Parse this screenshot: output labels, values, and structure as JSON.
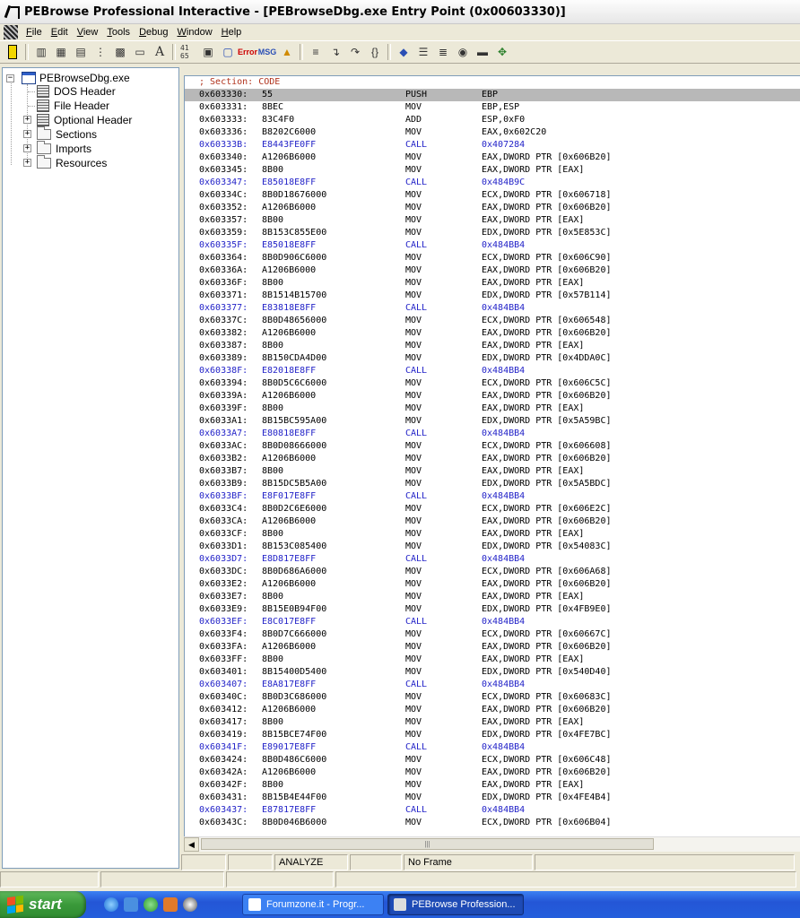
{
  "window": {
    "title": "PEBrowse Professional Interactive - [PEBrowseDbg.exe Entry Point (0x00603330)]"
  },
  "menu": [
    {
      "label": "File",
      "u": "F",
      "rest": "ile"
    },
    {
      "label": "Edit",
      "u": "E",
      "rest": "dit"
    },
    {
      "label": "View",
      "u": "V",
      "rest": "iew"
    },
    {
      "label": "Tools",
      "u": "T",
      "rest": "ools"
    },
    {
      "label": "Debug",
      "u": "D",
      "rest": "ebug"
    },
    {
      "label": "Window",
      "u": "W",
      "rest": "indow"
    },
    {
      "label": "Help",
      "u": "H",
      "rest": "elp"
    }
  ],
  "toolbar": {
    "icons": [
      "open-icon",
      "chart-icon",
      "grid-icon",
      "print-icon",
      "tree-icon",
      "pe-icon",
      "hex-icon",
      "font-icon",
      "bytes-icon",
      "calculator-icon",
      "copy-icon",
      "error-icon",
      "msg-icon",
      "user-icon",
      "doc-icon",
      "step-into-icon",
      "step-over-icon",
      "step-out-icon",
      "tag-icon",
      "list-icon",
      "list2-icon",
      "disk-icon",
      "monitor-icon",
      "modules-icon"
    ],
    "labels": {
      "bytes": "41 65",
      "error": "Error",
      "msg": "MSG"
    }
  },
  "tree": {
    "root": "PEBrowseDbg.exe",
    "items": [
      "DOS Header",
      "File Header",
      "Optional Header",
      "Sections",
      "Imports",
      "Resources"
    ]
  },
  "disasm": {
    "section_label": "; Section: CODE",
    "rows": [
      [
        "0x603330:",
        "55",
        "PUSH",
        "EBP"
      ],
      [
        "0x603331:",
        "8BEC",
        "MOV",
        "EBP,ESP"
      ],
      [
        "0x603333:",
        "83C4F0",
        "ADD",
        "ESP,0xF0"
      ],
      [
        "0x603336:",
        "B8202C6000",
        "MOV",
        "EAX,0x602C20"
      ],
      [
        "0x60333B:",
        "E8443FE0FF",
        "CALL",
        "0x407284"
      ],
      [
        "0x603340:",
        "A1206B6000",
        "MOV",
        "EAX,DWORD PTR [0x606B20]"
      ],
      [
        "0x603345:",
        "8B00",
        "MOV",
        "EAX,DWORD PTR [EAX]"
      ],
      [
        "0x603347:",
        "E85018E8FF",
        "CALL",
        "0x484B9C"
      ],
      [
        "0x60334C:",
        "8B0D18676000",
        "MOV",
        "ECX,DWORD PTR [0x606718]"
      ],
      [
        "0x603352:",
        "A1206B6000",
        "MOV",
        "EAX,DWORD PTR [0x606B20]"
      ],
      [
        "0x603357:",
        "8B00",
        "MOV",
        "EAX,DWORD PTR [EAX]"
      ],
      [
        "0x603359:",
        "8B153C855E00",
        "MOV",
        "EDX,DWORD PTR [0x5E853C]"
      ],
      [
        "0x60335F:",
        "E85018E8FF",
        "CALL",
        "0x484BB4"
      ],
      [
        "0x603364:",
        "8B0D906C6000",
        "MOV",
        "ECX,DWORD PTR [0x606C90]"
      ],
      [
        "0x60336A:",
        "A1206B6000",
        "MOV",
        "EAX,DWORD PTR [0x606B20]"
      ],
      [
        "0x60336F:",
        "8B00",
        "MOV",
        "EAX,DWORD PTR [EAX]"
      ],
      [
        "0x603371:",
        "8B1514B15700",
        "MOV",
        "EDX,DWORD PTR [0x57B114]"
      ],
      [
        "0x603377:",
        "E83818E8FF",
        "CALL",
        "0x484BB4"
      ],
      [
        "0x60337C:",
        "8B0D48656000",
        "MOV",
        "ECX,DWORD PTR [0x606548]"
      ],
      [
        "0x603382:",
        "A1206B6000",
        "MOV",
        "EAX,DWORD PTR [0x606B20]"
      ],
      [
        "0x603387:",
        "8B00",
        "MOV",
        "EAX,DWORD PTR [EAX]"
      ],
      [
        "0x603389:",
        "8B150CDA4D00",
        "MOV",
        "EDX,DWORD PTR [0x4DDA0C]"
      ],
      [
        "0x60338F:",
        "E82018E8FF",
        "CALL",
        "0x484BB4"
      ],
      [
        "0x603394:",
        "8B0D5C6C6000",
        "MOV",
        "ECX,DWORD PTR [0x606C5C]"
      ],
      [
        "0x60339A:",
        "A1206B6000",
        "MOV",
        "EAX,DWORD PTR [0x606B20]"
      ],
      [
        "0x60339F:",
        "8B00",
        "MOV",
        "EAX,DWORD PTR [EAX]"
      ],
      [
        "0x6033A1:",
        "8B15BC595A00",
        "MOV",
        "EDX,DWORD PTR [0x5A59BC]"
      ],
      [
        "0x6033A7:",
        "E80818E8FF",
        "CALL",
        "0x484BB4"
      ],
      [
        "0x6033AC:",
        "8B0D08666000",
        "MOV",
        "ECX,DWORD PTR [0x606608]"
      ],
      [
        "0x6033B2:",
        "A1206B6000",
        "MOV",
        "EAX,DWORD PTR [0x606B20]"
      ],
      [
        "0x6033B7:",
        "8B00",
        "MOV",
        "EAX,DWORD PTR [EAX]"
      ],
      [
        "0x6033B9:",
        "8B15DC5B5A00",
        "MOV",
        "EDX,DWORD PTR [0x5A5BDC]"
      ],
      [
        "0x6033BF:",
        "E8F017E8FF",
        "CALL",
        "0x484BB4"
      ],
      [
        "0x6033C4:",
        "8B0D2C6E6000",
        "MOV",
        "ECX,DWORD PTR [0x606E2C]"
      ],
      [
        "0x6033CA:",
        "A1206B6000",
        "MOV",
        "EAX,DWORD PTR [0x606B20]"
      ],
      [
        "0x6033CF:",
        "8B00",
        "MOV",
        "EAX,DWORD PTR [EAX]"
      ],
      [
        "0x6033D1:",
        "8B153C085400",
        "MOV",
        "EDX,DWORD PTR [0x54083C]"
      ],
      [
        "0x6033D7:",
        "E8D817E8FF",
        "CALL",
        "0x484BB4"
      ],
      [
        "0x6033DC:",
        "8B0D686A6000",
        "MOV",
        "ECX,DWORD PTR [0x606A68]"
      ],
      [
        "0x6033E2:",
        "A1206B6000",
        "MOV",
        "EAX,DWORD PTR [0x606B20]"
      ],
      [
        "0x6033E7:",
        "8B00",
        "MOV",
        "EAX,DWORD PTR [EAX]"
      ],
      [
        "0x6033E9:",
        "8B15E0B94F00",
        "MOV",
        "EDX,DWORD PTR [0x4FB9E0]"
      ],
      [
        "0x6033EF:",
        "E8C017E8FF",
        "CALL",
        "0x484BB4"
      ],
      [
        "0x6033F4:",
        "8B0D7C666000",
        "MOV",
        "ECX,DWORD PTR [0x60667C]"
      ],
      [
        "0x6033FA:",
        "A1206B6000",
        "MOV",
        "EAX,DWORD PTR [0x606B20]"
      ],
      [
        "0x6033FF:",
        "8B00",
        "MOV",
        "EAX,DWORD PTR [EAX]"
      ],
      [
        "0x603401:",
        "8B15400D5400",
        "MOV",
        "EDX,DWORD PTR [0x540D40]"
      ],
      [
        "0x603407:",
        "E8A817E8FF",
        "CALL",
        "0x484BB4"
      ],
      [
        "0x60340C:",
        "8B0D3C686000",
        "MOV",
        "ECX,DWORD PTR [0x60683C]"
      ],
      [
        "0x603412:",
        "A1206B6000",
        "MOV",
        "EAX,DWORD PTR [0x606B20]"
      ],
      [
        "0x603417:",
        "8B00",
        "MOV",
        "EAX,DWORD PTR [EAX]"
      ],
      [
        "0x603419:",
        "8B15BCE74F00",
        "MOV",
        "EDX,DWORD PTR [0x4FE7BC]"
      ],
      [
        "0x60341F:",
        "E89017E8FF",
        "CALL",
        "0x484BB4"
      ],
      [
        "0x603424:",
        "8B0D486C6000",
        "MOV",
        "ECX,DWORD PTR [0x606C48]"
      ],
      [
        "0x60342A:",
        "A1206B6000",
        "MOV",
        "EAX,DWORD PTR [0x606B20]"
      ],
      [
        "0x60342F:",
        "8B00",
        "MOV",
        "EAX,DWORD PTR [EAX]"
      ],
      [
        "0x603431:",
        "8B15B4E44F00",
        "MOV",
        "EDX,DWORD PTR [0x4FE4B4]"
      ],
      [
        "0x603437:",
        "E87817E8FF",
        "CALL",
        "0x484BB4"
      ],
      [
        "0x60343C:",
        "8B0D046B6000",
        "MOV",
        "ECX,DWORD PTR [0x606B04]"
      ]
    ],
    "selected_row": 0
  },
  "mdi_status": [
    "",
    "",
    "ANALYZE",
    "",
    "No Frame",
    ""
  ],
  "taskbar": {
    "start_label": "start",
    "quick_launch": [
      "ie-icon",
      "outlook-icon",
      "messenger-icon",
      "app-icon",
      "clock-icon"
    ],
    "tasks": [
      {
        "label": "Forumzone.it - Progr...",
        "active": false
      },
      {
        "label": "PEBrowse Profession...",
        "active": true
      }
    ]
  },
  "colors": {
    "call_row": "#2323c8",
    "section_label": "#b0321c",
    "selected_row": "#b8b8b8",
    "taskbar": "#245edc",
    "start_button": "#3a9a3a"
  }
}
